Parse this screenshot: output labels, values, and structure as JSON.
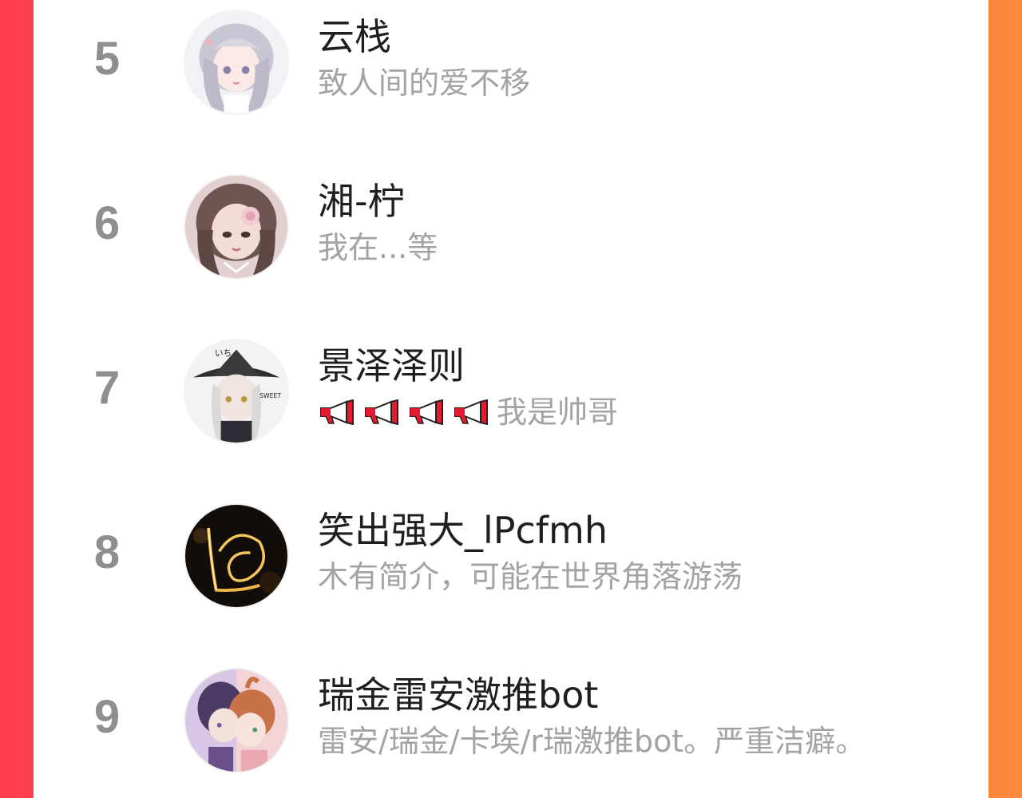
{
  "ranking": {
    "items": [
      {
        "rank": "5",
        "name": "云栈",
        "bio": "致人间的爱不移",
        "avatar": "anime-girl-silver-hair-avatar"
      },
      {
        "rank": "6",
        "name": "湘-柠",
        "bio": "我在...等",
        "avatar": "anime-girl-rose-avatar"
      },
      {
        "rank": "7",
        "name": "景泽泽则",
        "bio_prefix_icons": [
          "megaphone-icon",
          "megaphone-icon",
          "megaphone-icon",
          "megaphone-icon"
        ],
        "bio": "我是帅哥",
        "avatar": "anime-witch-hat-avatar"
      },
      {
        "rank": "8",
        "name": "笑出强大_lPcfmh",
        "bio": "木有简介，可能在世界角落游荡",
        "avatar": "light-painting-avatar"
      },
      {
        "rank": "9",
        "name": "瑞金雷安激推bot",
        "bio": "雷安/瑞金/卡埃/r瑞激推bot。严重洁癖。",
        "avatar": "anime-duo-avatar"
      }
    ]
  },
  "colors": {
    "background_left": "#ff3d4f",
    "background_right": "#ff8a3d",
    "rank_text": "#8f8f8f",
    "name_text": "#1f1f1f",
    "bio_text": "#a3a3a3",
    "megaphone_red": "#e8192c"
  }
}
